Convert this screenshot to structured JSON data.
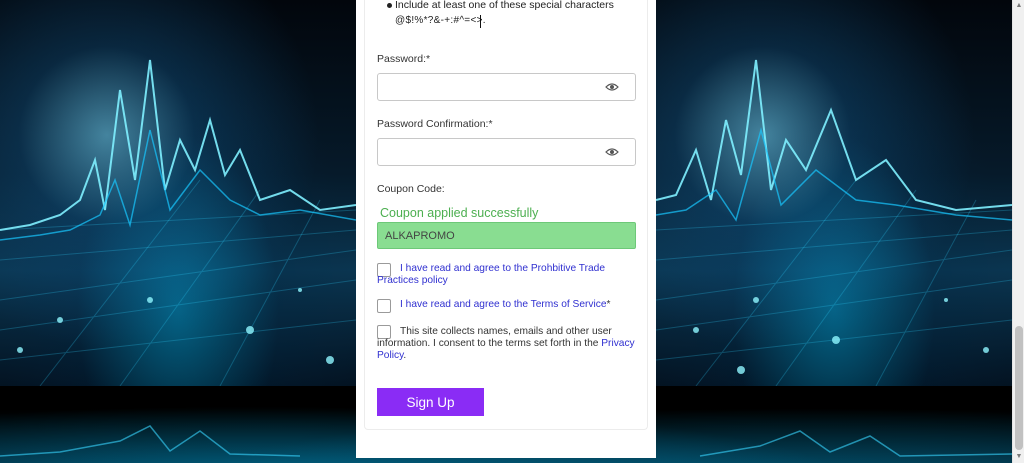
{
  "password_rules": {
    "special_chars_rule": "Include at least one of these special characters",
    "special_chars_list": "@$!%*?&-+:#^=<>."
  },
  "form": {
    "password_label": "Password:*",
    "password_confirm_label": "Password Confirmation:*",
    "coupon_label": "Coupon Code:",
    "coupon_success": "Coupon applied successfully",
    "coupon_value": "ALKAPROMO",
    "eye_icon": "eye-icon",
    "success_color": "#4caf50",
    "coupon_bg_color": "#89dd91"
  },
  "agreements": {
    "trade_practices_link": "I have read and agree to the Prohbitive Trade Practices policy",
    "terms_link": "I have read and agree to the Terms of Service",
    "terms_required": "*",
    "privacy_text": "This site collects names, emails and other user information. I consent to the terms set forth in the",
    "privacy_link": "Privacy Policy",
    "privacy_end": ".",
    "link_color": "#3030d0"
  },
  "signup_button": {
    "label": "Sign Up",
    "color": "#8a2cf5"
  }
}
